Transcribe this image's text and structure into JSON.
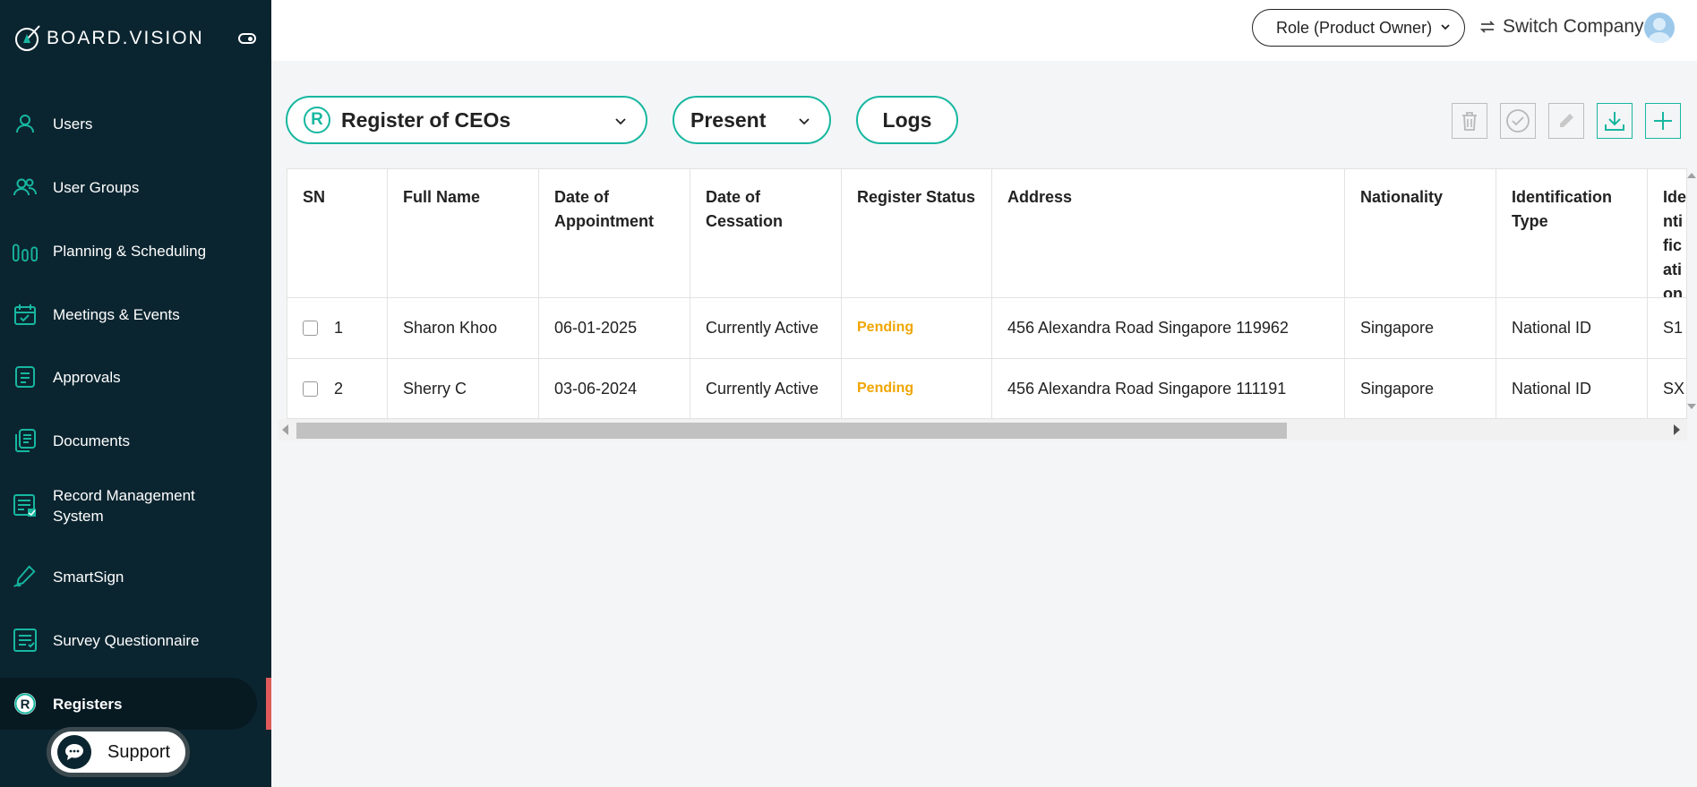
{
  "brand": {
    "name": "BOARD.VISION",
    "logo_icon": "compass-logo-icon"
  },
  "sidebar": {
    "items": [
      {
        "label": "Users",
        "icon": "user-icon"
      },
      {
        "label": "User Groups",
        "icon": "user-group-icon"
      },
      {
        "label": "Planning & Scheduling",
        "icon": "planning-icon"
      },
      {
        "label": "Meetings & Events",
        "icon": "calendar-icon"
      },
      {
        "label": "Approvals",
        "icon": "approvals-icon"
      },
      {
        "label": "Documents",
        "icon": "documents-icon"
      },
      {
        "label": "Record Management System",
        "icon": "record-icon"
      },
      {
        "label": "SmartSign",
        "icon": "pen-icon"
      },
      {
        "label": "Survey Questionnaire",
        "icon": "survey-icon"
      },
      {
        "label": "Registers",
        "icon": "registers-icon",
        "active": true
      }
    ],
    "support_label": "Support"
  },
  "header": {
    "role_label": "Role (Product Owner)",
    "switch_company_label": "Switch Company"
  },
  "toolbar": {
    "register_badge": "R",
    "register_select": "Register of CEOs",
    "period_select": "Present",
    "logs_label": "Logs",
    "actions": [
      "delete-icon",
      "approve-icon",
      "edit-icon",
      "download-icon",
      "add-icon"
    ]
  },
  "table": {
    "columns": [
      "SN",
      "Full Name",
      "Date of Appointment",
      "Date of Cessation",
      "Register Status",
      "Address",
      "Nationality",
      "Identification Type",
      "Identification No"
    ],
    "rows": [
      {
        "sn": "1",
        "full_name": "Sharon Khoo",
        "date_appointment": "06-01-2025",
        "date_cessation": "Currently Active",
        "status": "Pending",
        "address": "456 Alexandra Road Singapore 119962",
        "nationality": "Singapore",
        "id_type": "National ID",
        "id_no": "S1"
      },
      {
        "sn": "2",
        "full_name": "Sherry C",
        "date_appointment": "03-06-2024",
        "date_cessation": "Currently Active",
        "status": "Pending",
        "address": "456 Alexandra Road Singapore 111191",
        "nationality": "Singapore",
        "id_type": "National ID",
        "id_no": "SX"
      }
    ]
  },
  "colors": {
    "sidebar_bg": "#0b2530",
    "accent": "#17b7a0",
    "pending": "#f0a500",
    "active_marker": "#e05a5a"
  }
}
